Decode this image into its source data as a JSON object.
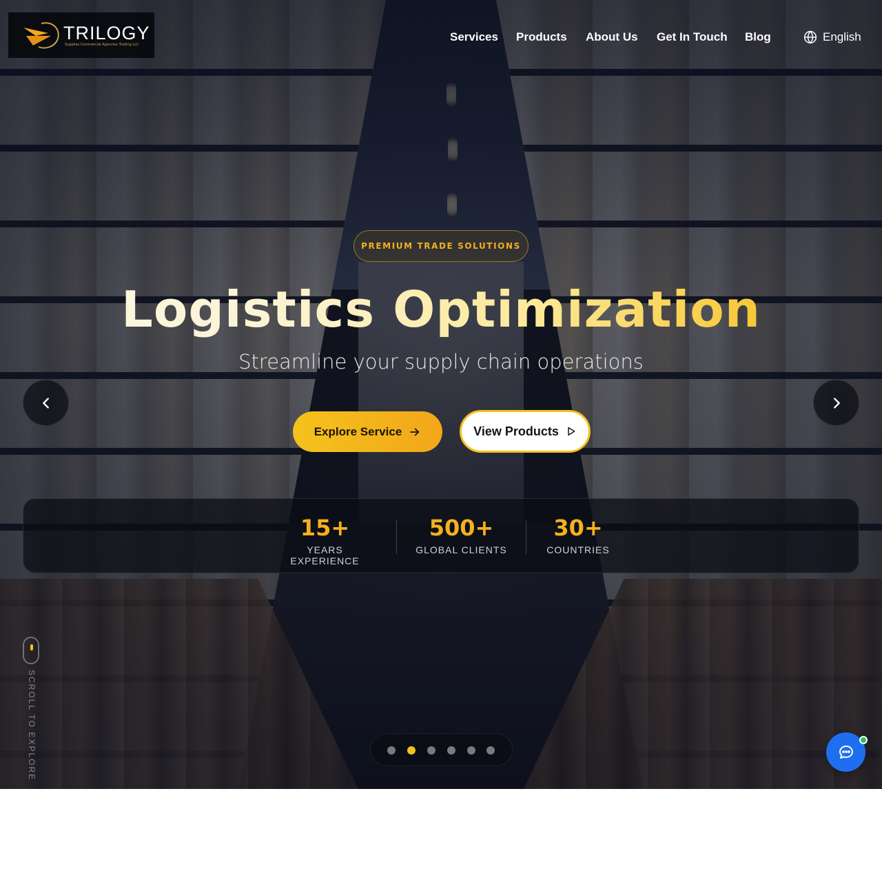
{
  "brand": {
    "name": "TRILOGY",
    "subtitle": "Supplies Commercial Agencies Trading LLC",
    "accent": "#f4c21c"
  },
  "nav": {
    "items": [
      {
        "label": "Services"
      },
      {
        "label": "Products"
      },
      {
        "label": "About Us"
      },
      {
        "label": "Get In Touch"
      },
      {
        "label": "Blog"
      }
    ],
    "language": "English",
    "language_icon": "globe-icon"
  },
  "hero": {
    "tag": "PREMIUM TRADE SOLUTIONS",
    "title": "Logistics Optimization",
    "subtitle": "Streamline your supply chain operations",
    "primary_button": "Explore Service",
    "primary_icon": "arrow-right-icon",
    "secondary_button": "View Products",
    "secondary_icon": "play-icon",
    "prev_icon": "chevron-left-icon",
    "next_icon": "chevron-right-icon"
  },
  "stats": [
    {
      "value": "15+",
      "label": "YEARS EXPERIENCE"
    },
    {
      "value": "500+",
      "label": "GLOBAL CLIENTS"
    },
    {
      "value": "30+",
      "label": "COUNTRIES"
    }
  ],
  "scroll_hint": "SCROLL TO EXPLORE",
  "carousel": {
    "total_slides": 6,
    "active_slide": 2
  },
  "chat": {
    "icon": "chat-icon",
    "status_color": "#22c55e",
    "button_color": "#1f6ef0"
  }
}
